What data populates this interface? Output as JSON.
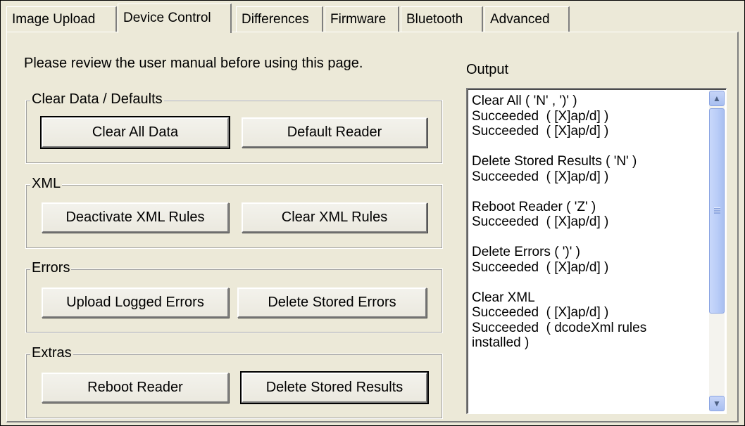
{
  "tabs": [
    "Image Upload",
    "Device Control",
    "Differences",
    "Firmware",
    "Bluetooth",
    "Advanced"
  ],
  "active_tab": "Device Control",
  "intro_text": "Please review the user manual before using this page.",
  "output": {
    "label": "Output",
    "text": "Clear All ( 'N' , ')' )\nSucceeded  ( [X]ap/d] )\nSucceeded  ( [X]ap/d] )\n\nDelete Stored Results ( 'N' )\nSucceeded  ( [X]ap/d] )\n\nReboot Reader ( 'Z' )\nSucceeded  ( [X]ap/d] )\n\nDelete Errors ( ')' )\nSucceeded  ( [X]ap/d] )\n\nClear XML\nSucceeded  ( [X]ap/d] )\nSucceeded  ( dcodeXml rules\ninstalled )"
  },
  "groups": {
    "clear": {
      "legend": "Clear Data / Defaults",
      "btn1": "Clear All Data",
      "btn2": "Default Reader"
    },
    "xml": {
      "legend": "XML",
      "btn1": "Deactivate XML Rules",
      "btn2": "Clear XML Rules"
    },
    "errors": {
      "legend": "Errors",
      "btn1": "Upload Logged Errors",
      "btn2": "Delete Stored Errors"
    },
    "extras": {
      "legend": "Extras",
      "btn1": "Reboot Reader",
      "btn2": "Delete Stored Results"
    }
  },
  "icons": {
    "scroll_up": "chevron-up-icon",
    "scroll_down": "chevron-down-icon"
  },
  "colors": {
    "window_bg": "#ece9d8",
    "scrollbar_blue": "#b7cbf7"
  }
}
